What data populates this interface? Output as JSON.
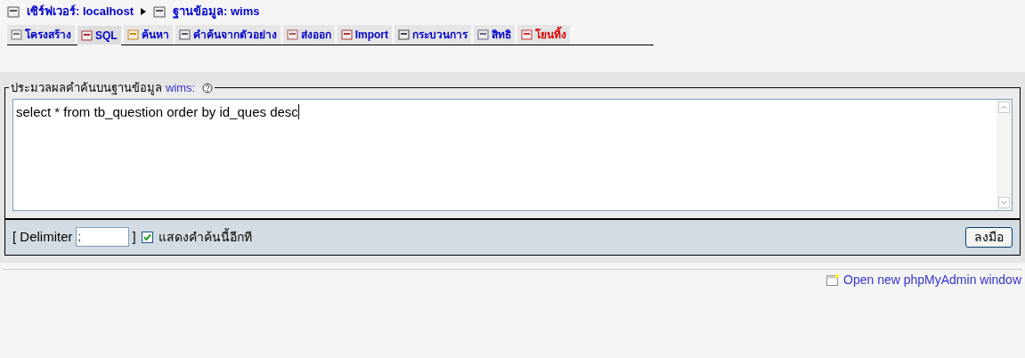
{
  "breadcrumb": [
    {
      "label": "เซิร์ฟเวอร์: localhost"
    },
    {
      "label": "ฐานข้อมูล: wims"
    }
  ],
  "tabs": [
    {
      "label": "โครงสร้าง",
      "selected": false,
      "kind": "normal"
    },
    {
      "label": "SQL",
      "selected": true,
      "kind": "normal"
    },
    {
      "label": "ค้นหา",
      "selected": false,
      "kind": "normal"
    },
    {
      "label": "คำค้นจากตัวอย่าง",
      "selected": false,
      "kind": "normal"
    },
    {
      "label": "ส่งออก",
      "selected": false,
      "kind": "normal"
    },
    {
      "label": "Import",
      "selected": false,
      "kind": "normal"
    },
    {
      "label": "กระบวนการ",
      "selected": false,
      "kind": "normal"
    },
    {
      "label": "สิทธิ",
      "selected": false,
      "kind": "normal"
    },
    {
      "label": "โยนทิ้ง",
      "selected": false,
      "kind": "danger"
    }
  ],
  "query_panel": {
    "legend": "ประมวลผลคำค้นบนฐานข้อมูล",
    "database_link": "wims:",
    "query": "select * from tb_question order by id_ques desc",
    "delimiter_open": "[ Delimiter",
    "delimiter_value": ";",
    "delimiter_close": "]",
    "show_again": {
      "label": "แสดงคำค้นนี้อีกที",
      "checked": true
    },
    "submit": "ลงมือ"
  },
  "footer_link": "Open new phpMyAdmin window"
}
